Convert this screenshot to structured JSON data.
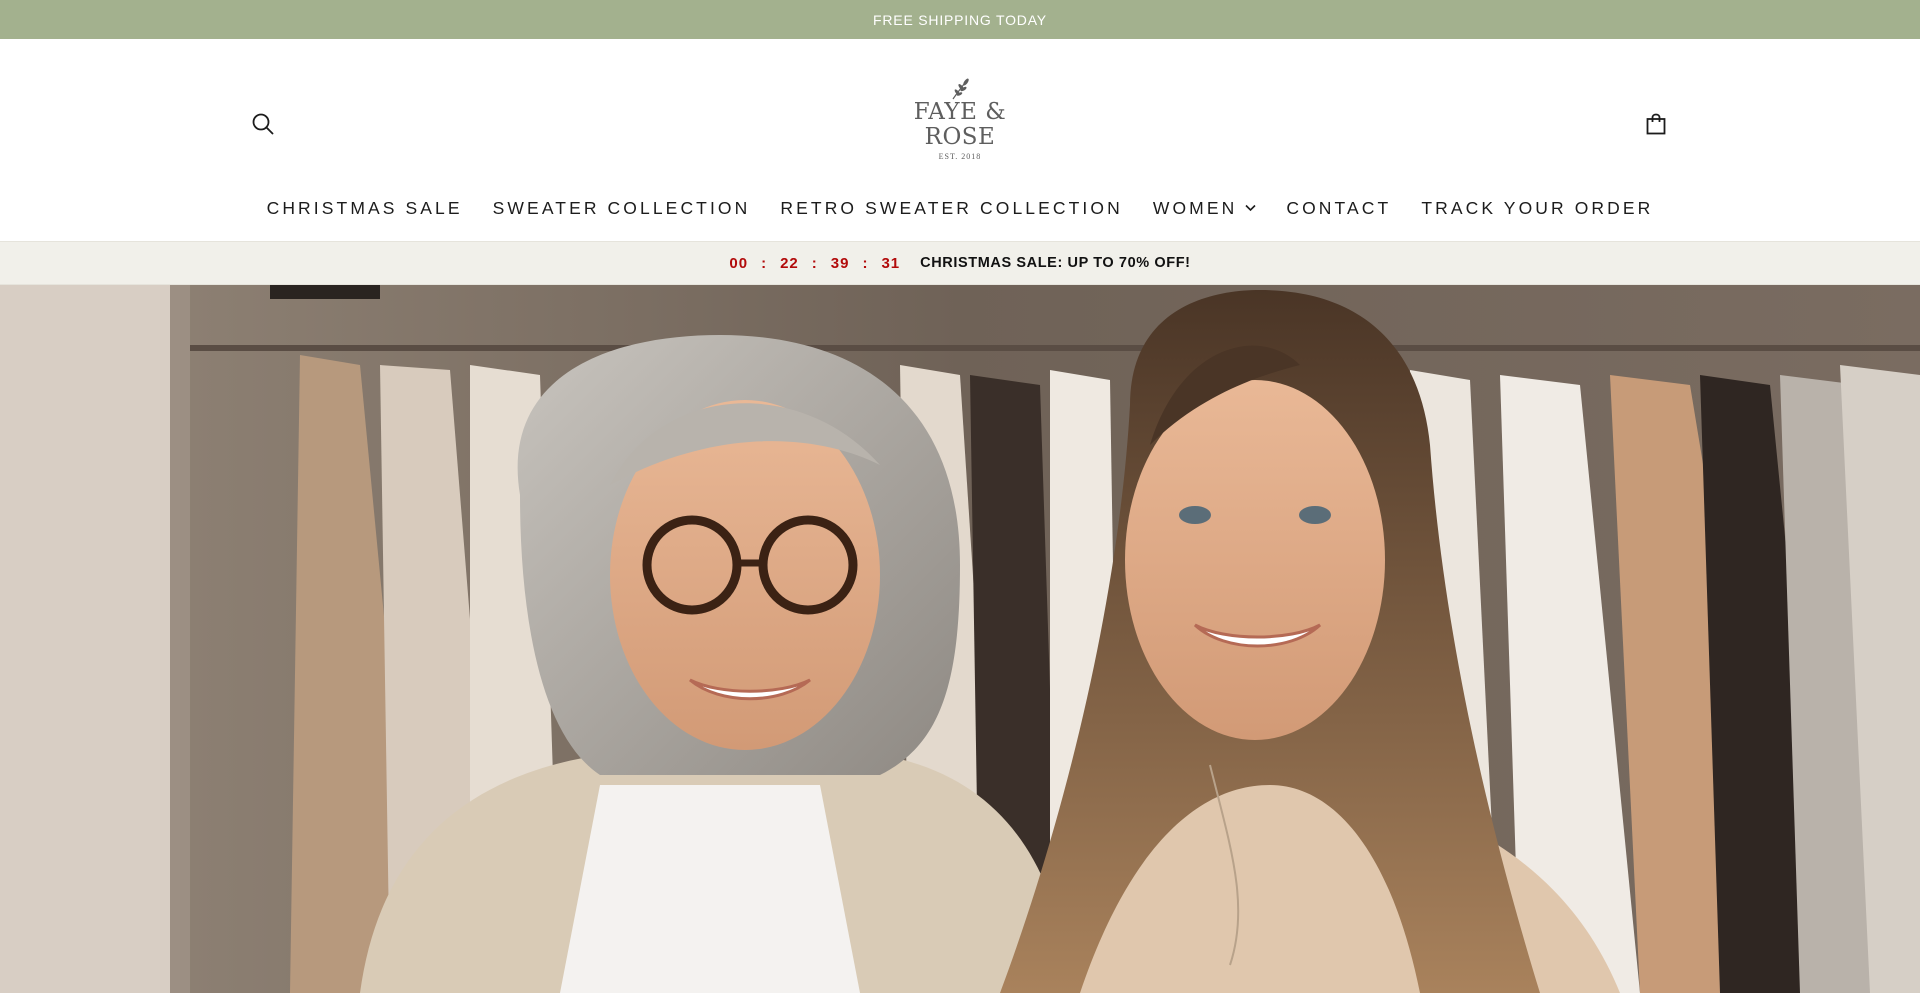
{
  "announcement": {
    "text": "FREE SHIPPING TODAY"
  },
  "header": {
    "logo": {
      "line1": "FAYE &",
      "line2": "ROSE",
      "est": "EST. 2018"
    },
    "search_icon": "search-icon",
    "cart_icon": "shopping-bag-icon"
  },
  "nav": {
    "items": [
      {
        "label": "CHRISTMAS SALE"
      },
      {
        "label": "SWEATER COLLECTION"
      },
      {
        "label": "RETRO SWEATER COLLECTION"
      },
      {
        "label": "WOMEN",
        "has_dropdown": true
      },
      {
        "label": "CONTACT"
      },
      {
        "label": "TRACK YOUR ORDER"
      }
    ]
  },
  "countdown": {
    "hours": "00",
    "minutes": "22",
    "seconds": "39",
    "centis": "31",
    "separator": ":",
    "message": "CHRISTMAS SALE: UP TO 70% OFF!"
  },
  "colors": {
    "announcement_bg": "#a3b18e",
    "timer_red": "#b20b0b",
    "countdown_bg": "#f1f0ea"
  }
}
